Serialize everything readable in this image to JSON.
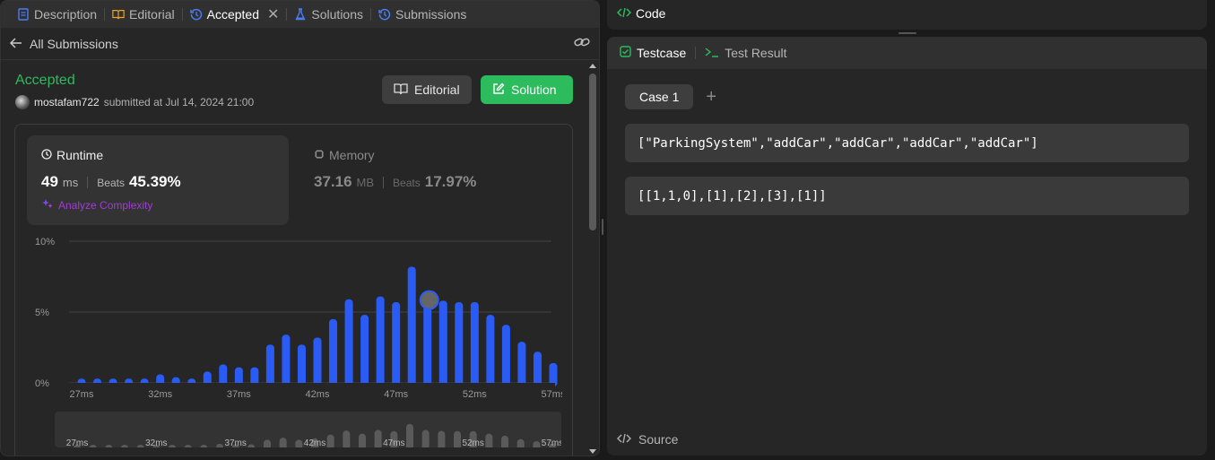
{
  "tabs": [
    {
      "label": "Description",
      "icon": "description-icon"
    },
    {
      "label": "Editorial",
      "icon": "book-icon"
    },
    {
      "label": "Accepted",
      "icon": "history-icon",
      "active": true
    },
    {
      "label": "Solutions",
      "icon": "flask-icon"
    },
    {
      "label": "Submissions",
      "icon": "history-icon"
    }
  ],
  "subheader": {
    "back_label": "All Submissions"
  },
  "submission": {
    "status": "Accepted",
    "username": "mostafam722",
    "submitted_text": "submitted at Jul 14, 2024 21:00"
  },
  "buttons": {
    "editorial": "Editorial",
    "solution": "Solution"
  },
  "runtime": {
    "title": "Runtime",
    "value": "49",
    "unit": "ms",
    "beats_label": "Beats",
    "beats": "45.39%",
    "analyze": "Analyze Complexity"
  },
  "memory": {
    "title": "Memory",
    "value": "37.16",
    "unit": "MB",
    "beats_label": "Beats",
    "beats": "17.97%"
  },
  "colors": {
    "accent_green": "#2cbb5d",
    "bar_blue": "#2a5cf5",
    "analyze_purple": "#a33bd6"
  },
  "chart_data": {
    "type": "bar",
    "categories": [
      "27ms",
      "28ms",
      "29ms",
      "30ms",
      "31ms",
      "32ms",
      "33ms",
      "34ms",
      "35ms",
      "36ms",
      "37ms",
      "38ms",
      "39ms",
      "40ms",
      "41ms",
      "42ms",
      "43ms",
      "44ms",
      "45ms",
      "46ms",
      "47ms",
      "48ms",
      "49ms",
      "50ms",
      "51ms",
      "52ms",
      "53ms",
      "54ms",
      "55ms",
      "56ms",
      "57ms"
    ],
    "x_tick_labels": [
      "27ms",
      "32ms",
      "37ms",
      "42ms",
      "47ms",
      "52ms",
      "57ms"
    ],
    "y_tick_labels": [
      "10%",
      "5%",
      "0%"
    ],
    "values": [
      0.3,
      0.3,
      0.3,
      0.3,
      0.3,
      0.6,
      0.4,
      0.3,
      0.8,
      1.3,
      1.1,
      1.1,
      2.7,
      3.4,
      2.7,
      3.2,
      4.5,
      5.9,
      4.8,
      6.1,
      5.7,
      8.2,
      6.1,
      5.8,
      5.7,
      5.7,
      4.8,
      4.1,
      2.9,
      2.2,
      1.4
    ],
    "highlight_index": 22,
    "ylim": [
      0,
      10
    ],
    "grid": true
  },
  "code_panel": {
    "title": "Code"
  },
  "test_panel": {
    "tab_testcase": "Testcase",
    "tab_result": "Test Result",
    "case_label": "Case 1",
    "plus": "+",
    "input1": "[\"ParkingSystem\",\"addCar\",\"addCar\",\"addCar\",\"addCar\"]",
    "input2": "[[1,1,0],[1],[2],[3],[1]]",
    "source": "Source"
  }
}
